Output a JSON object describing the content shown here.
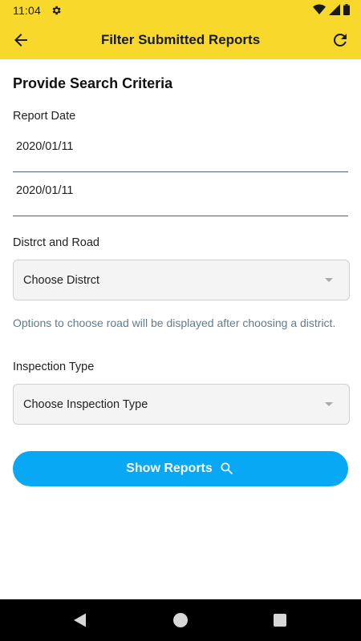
{
  "status_bar": {
    "time": "11:04",
    "icons": [
      "settings-icon",
      "wifi-icon",
      "cell-signal-icon",
      "battery-icon"
    ]
  },
  "app_bar": {
    "title": "Filter Submitted Reports",
    "back_icon": "arrow-back-icon",
    "refresh_icon": "refresh-icon",
    "background": "#f8d82a"
  },
  "form": {
    "heading": "Provide Search Criteria",
    "report_date": {
      "label": "Report Date",
      "from_value": "2020/01/11",
      "to_value": "2020/01/11"
    },
    "district_road": {
      "label": "Distrct and Road",
      "select_value": "Choose Distrct",
      "hint": "Options to choose road will be displayed after choosing a district."
    },
    "inspection_type": {
      "label": "Inspection Type",
      "select_value": "Choose Inspection Type"
    },
    "submit": {
      "label": "Show Reports",
      "icon": "search-icon",
      "color": "#08a8f4"
    }
  },
  "nav_bar": {
    "icons": [
      "nav-back-icon",
      "nav-home-icon",
      "nav-recents-icon"
    ]
  }
}
